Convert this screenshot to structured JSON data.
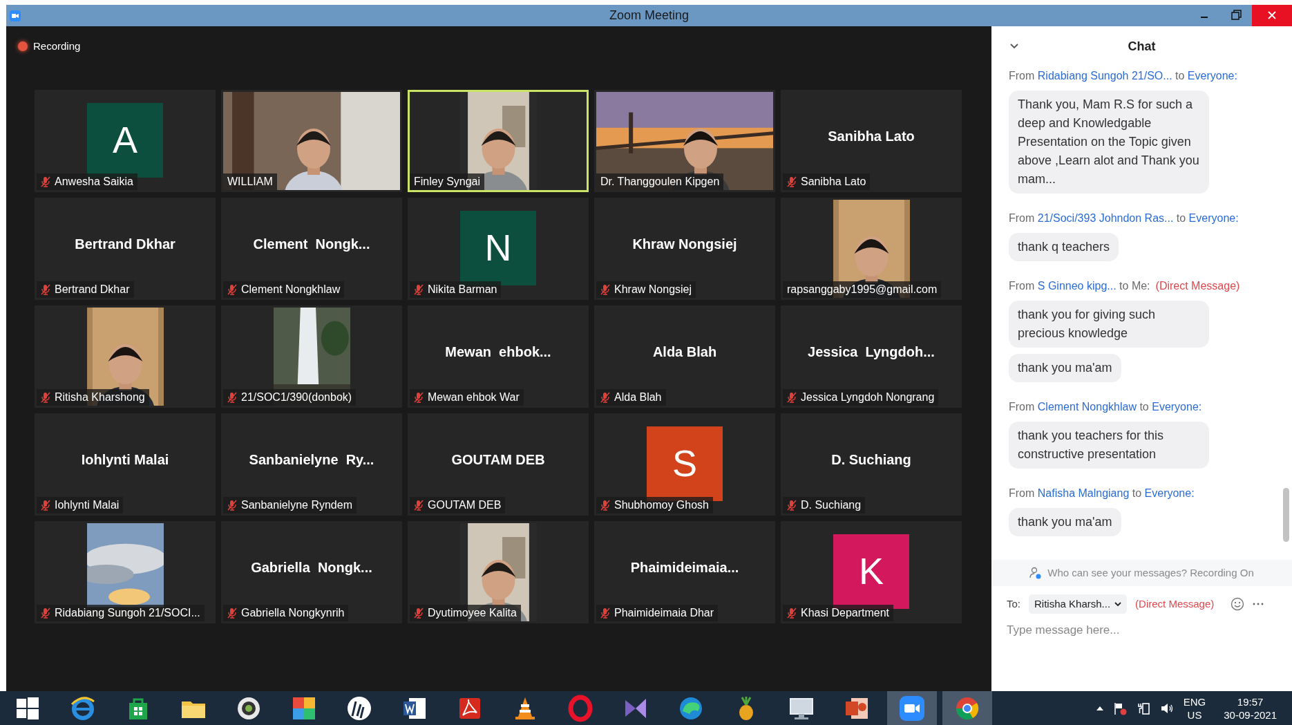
{
  "window": {
    "title": "Zoom Meeting"
  },
  "recording": {
    "label": "Recording"
  },
  "tiles": [
    {
      "name": "Anwesha Saikia",
      "kind": "avatar",
      "initial": "A",
      "color": "#0c4f3f",
      "muted": true,
      "selected": false
    },
    {
      "name": "WILLIAM",
      "kind": "video",
      "muted": false,
      "selected": false
    },
    {
      "name": "Finley Syngai",
      "kind": "thumbnail",
      "muted": false,
      "selected": true
    },
    {
      "name": "Dr. Thanggoulen Kipgen",
      "kind": "video",
      "muted": false,
      "selected": false
    },
    {
      "name": "Sanibha Lato",
      "kind": "name",
      "title": "Sanibha Lato",
      "muted": true,
      "selected": false
    },
    {
      "name": "Bertrand Dkhar",
      "kind": "name",
      "title": "Bertrand Dkhar",
      "muted": true,
      "selected": false
    },
    {
      "name": "Clement Nongkhlaw",
      "kind": "name",
      "title": "Clement  Nongk...",
      "muted": true,
      "selected": false
    },
    {
      "name": "Nikita Barman",
      "kind": "avatar",
      "initial": "N",
      "color": "#0c4f3f",
      "muted": true,
      "selected": false
    },
    {
      "name": "Khraw Nongsiej",
      "kind": "name",
      "title": "Khraw Nongsiej",
      "muted": true,
      "selected": false
    },
    {
      "name": "rapsanggaby1995@gmail.com",
      "kind": "thumbnail",
      "muted": false,
      "selected": false
    },
    {
      "name": "Ritisha Kharshong",
      "kind": "thumbnail",
      "muted": true,
      "selected": false
    },
    {
      "name": "21/SOC1/390(donbok)",
      "kind": "thumbnail",
      "muted": true,
      "selected": false
    },
    {
      "name": "Mewan ehbok War",
      "kind": "name",
      "title": "Mewan  ehbok...",
      "muted": true,
      "selected": false
    },
    {
      "name": "Alda Blah",
      "kind": "name",
      "title": "Alda Blah",
      "muted": true,
      "selected": false
    },
    {
      "name": "Jessica Lyngdoh Nongrang",
      "kind": "name",
      "title": "Jessica  Lyngdoh...",
      "muted": true,
      "selected": false
    },
    {
      "name": "Iohlynti Malai",
      "kind": "name",
      "title": "Iohlynti Malai",
      "muted": true,
      "selected": false
    },
    {
      "name": "Sanbanielyne Ryndem",
      "kind": "name",
      "title": "Sanbanielyne  Ry...",
      "muted": true,
      "selected": false
    },
    {
      "name": "GOUTAM DEB",
      "kind": "name",
      "title": "GOUTAM DEB",
      "muted": true,
      "selected": false
    },
    {
      "name": "Shubhomoy Ghosh",
      "kind": "avatar",
      "initial": "S",
      "color": "#d2421b",
      "muted": true,
      "selected": false
    },
    {
      "name": "D. Suchiang",
      "kind": "name",
      "title": "D. Suchiang",
      "muted": true,
      "selected": false
    },
    {
      "name": "Ridabiang Sungoh 21/SOCI...",
      "kind": "thumbnail",
      "muted": true,
      "selected": false
    },
    {
      "name": "Gabriella Nongkynrih",
      "kind": "name",
      "title": "Gabriella  Nongk...",
      "muted": true,
      "selected": false
    },
    {
      "name": "Dyutimoyee Kalita",
      "kind": "thumbnail",
      "muted": true,
      "selected": false
    },
    {
      "name": "Phaimideimaia Dhar",
      "kind": "name",
      "title": "Phaimideimaia...",
      "muted": true,
      "selected": false
    },
    {
      "name": "Khasi Department",
      "kind": "avatar",
      "initial": "K",
      "color": "#d3185e",
      "muted": true,
      "selected": false
    }
  ],
  "chat": {
    "title": "Chat",
    "messages": [
      {
        "from_label": "From",
        "sender": "Ridabiang Sungoh 21/SO...",
        "to_label": "to",
        "recipient": "Everyone:",
        "kind": "everyone",
        "bubbles": [
          "Thank you, Mam R.S for such a deep and Knowledgable Presentation on the Topic given above ,Learn alot and Thank you mam..."
        ]
      },
      {
        "from_label": "From",
        "sender": "21/Soci/393 Johndon Ras...",
        "to_label": "to",
        "recipient": "Everyone:",
        "kind": "everyone",
        "bubbles": [
          "thank q teachers"
        ]
      },
      {
        "from_label": "From",
        "sender": "S Ginneo kipg...",
        "to_label": "to",
        "recipient": "Me:",
        "kind": "direct",
        "note": "(Direct Message)",
        "bubbles": [
          "thank you for giving such precious knowledge",
          "thank you ma'am"
        ]
      },
      {
        "from_label": "From",
        "sender": "Clement Nongkhlaw",
        "to_label": "to",
        "recipient": "Everyone:",
        "kind": "everyone",
        "bubbles": [
          "thank you teachers for this constructive presentation"
        ]
      },
      {
        "from_label": "From",
        "sender": "Nafisha Malngiang",
        "to_label": "to",
        "recipient": "Everyone:",
        "kind": "everyone",
        "bubbles": [
          "thank you ma'am"
        ]
      }
    ],
    "privacy_note": "Who can see your messages? Recording On",
    "to_label": "To:",
    "recipient": "Ritisha Kharsh...",
    "note": "(Direct Message)",
    "placeholder": "Type message here..."
  },
  "taskbar": {
    "apps": [
      {
        "highlighted": false
      },
      {
        "highlighted": false
      },
      {
        "highlighted": false
      },
      {
        "highlighted": false
      },
      {
        "highlighted": false
      },
      {
        "highlighted": false
      },
      {
        "highlighted": false
      },
      {
        "highlighted": false
      },
      {
        "highlighted": false
      },
      {
        "highlighted": false
      },
      {
        "highlighted": false
      },
      {
        "highlighted": false
      },
      {
        "highlighted": false
      },
      {
        "highlighted": false
      },
      {
        "highlighted": false
      },
      {
        "highlighted": false
      },
      {
        "highlighted": true
      },
      {
        "highlighted": true
      }
    ],
    "language": "ENG",
    "region": "US",
    "time": "19:57",
    "date": "30-09-2021"
  }
}
